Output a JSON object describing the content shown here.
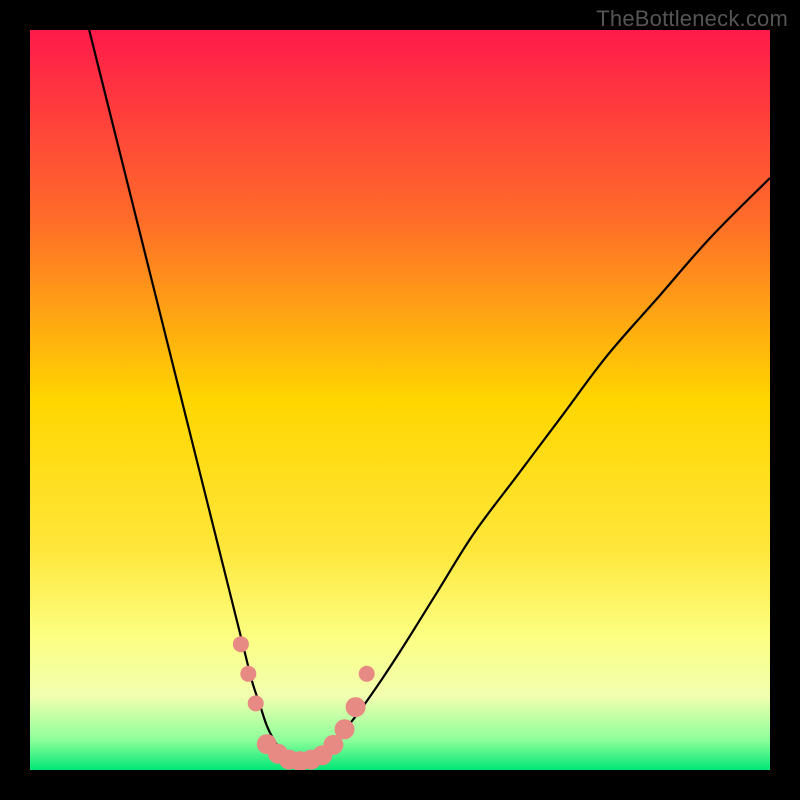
{
  "watermark": "TheBottleneck.com",
  "chart_data": {
    "type": "line",
    "title": "",
    "xlabel": "",
    "ylabel": "",
    "xlim": [
      0,
      100
    ],
    "ylim": [
      0,
      100
    ],
    "grid": false,
    "legend": false,
    "background_gradient": {
      "stops": [
        {
          "offset": 0.0,
          "color": "#ff1a4b"
        },
        {
          "offset": 0.25,
          "color": "#ff6a2a"
        },
        {
          "offset": 0.5,
          "color": "#ffd600"
        },
        {
          "offset": 0.7,
          "color": "#ffe63a"
        },
        {
          "offset": 0.82,
          "color": "#fcff82"
        },
        {
          "offset": 0.9,
          "color": "#f2ffb0"
        },
        {
          "offset": 0.96,
          "color": "#8cff9a"
        },
        {
          "offset": 1.0,
          "color": "#00e676"
        }
      ]
    },
    "series": [
      {
        "name": "left-curve",
        "x": [
          8,
          10,
          12,
          14,
          16,
          18,
          20,
          22,
          24,
          26,
          28,
          29,
          30,
          31,
          32,
          33,
          34,
          35,
          36
        ],
        "y": [
          100,
          92,
          84,
          76,
          68,
          60,
          52,
          44,
          36,
          28,
          20,
          16,
          12,
          9,
          6,
          4,
          2.5,
          1.5,
          1
        ]
      },
      {
        "name": "right-curve",
        "x": [
          36,
          38,
          40,
          43,
          46,
          50,
          55,
          60,
          66,
          72,
          78,
          85,
          92,
          100
        ],
        "y": [
          1,
          1.5,
          3,
          6,
          10,
          16,
          24,
          32,
          40,
          48,
          56,
          64,
          72,
          80
        ]
      }
    ],
    "markers": {
      "name": "bottom-dots",
      "color": "#e88a84",
      "radius_major": 10,
      "radius_minor": 8,
      "points": [
        {
          "x": 28.5,
          "y": 17,
          "r": 8
        },
        {
          "x": 29.5,
          "y": 13,
          "r": 8
        },
        {
          "x": 30.5,
          "y": 9,
          "r": 8
        },
        {
          "x": 32.0,
          "y": 3.5,
          "r": 10
        },
        {
          "x": 33.5,
          "y": 2.2,
          "r": 10
        },
        {
          "x": 35.0,
          "y": 1.4,
          "r": 10
        },
        {
          "x": 36.5,
          "y": 1.2,
          "r": 10
        },
        {
          "x": 38.0,
          "y": 1.4,
          "r": 10
        },
        {
          "x": 39.5,
          "y": 2.0,
          "r": 10
        },
        {
          "x": 41.0,
          "y": 3.4,
          "r": 10
        },
        {
          "x": 42.5,
          "y": 5.5,
          "r": 10
        },
        {
          "x": 44.0,
          "y": 8.5,
          "r": 10
        },
        {
          "x": 45.5,
          "y": 13.0,
          "r": 8
        }
      ]
    }
  }
}
